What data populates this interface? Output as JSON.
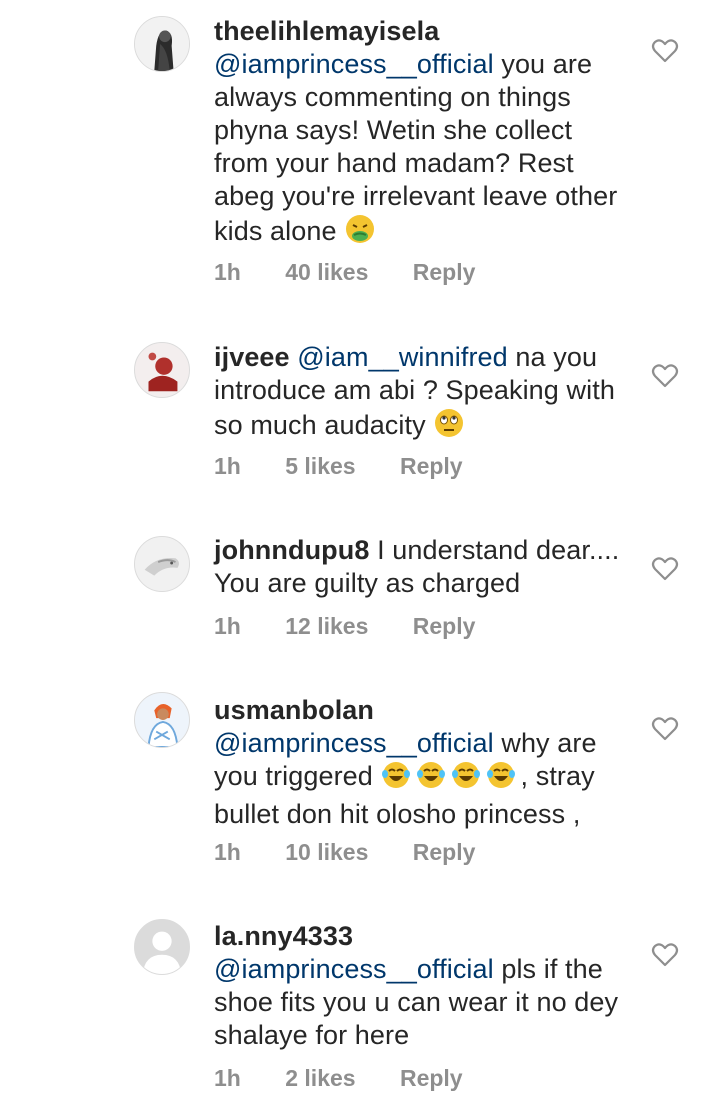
{
  "comments": [
    {
      "username": "theelihlemayisela",
      "mention": "@iamprincess__official",
      "body": "you are always commenting on things phyna says! Wetin she collect from your hand madam? Rest abeg you're irrelevant leave other kids alone",
      "emoji": "nauseated-face",
      "time": "1h",
      "likes": "40 likes",
      "reply": "Reply"
    },
    {
      "username": "ijveee",
      "mention": "@iam__winnifred",
      "body": "na you introduce am abi ? Speaking with so much audacity",
      "emoji": "eye-roll-face",
      "time": "1h",
      "likes": "5 likes",
      "reply": "Reply"
    },
    {
      "username": "johnndupu8",
      "mention": "",
      "body": "I understand dear.... You are guilty as charged",
      "time": "1h",
      "likes": "12 likes",
      "reply": "Reply"
    },
    {
      "username": "usmanbolan",
      "mention": "@iamprincess__official",
      "body": "why are you triggered",
      "emoji": "tears-of-joy-face x4",
      "body2": ", stray bullet don hit olosho princess ,",
      "time": "1h",
      "likes": "10 likes",
      "reply": "Reply"
    },
    {
      "username": "la.nny4333",
      "mention": "@iamprincess__official",
      "body": "pls if the shoe fits you u can wear it no dey shalaye for here",
      "time": "1h",
      "likes": "2 likes",
      "reply": "Reply"
    }
  ]
}
